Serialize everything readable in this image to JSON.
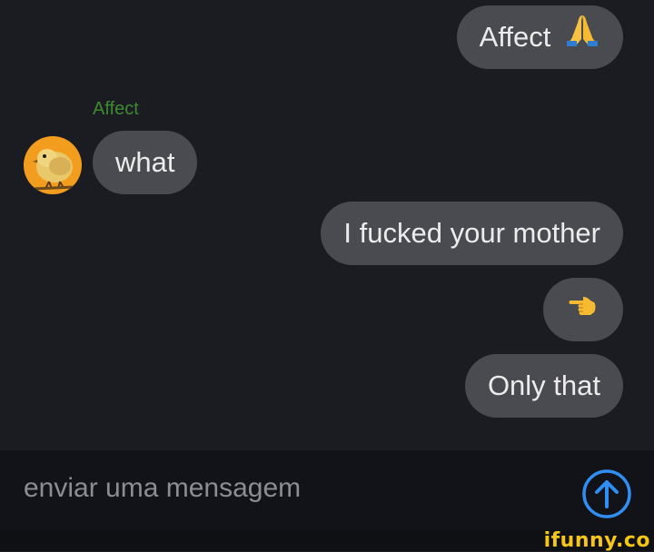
{
  "messages": [
    {
      "text": "Affect",
      "emoji": "praying-hands-icon"
    },
    {
      "sender": "Affect",
      "text": "what"
    },
    {
      "text": "I fucked your mother"
    },
    {
      "emoji": "hand-pointing-left-icon"
    },
    {
      "text": "Only that"
    }
  ],
  "composer": {
    "placeholder": "enviar uma mensagem"
  },
  "watermark": "ifunny.co",
  "colors": {
    "background": "#1b1c22",
    "bubble": "#4a4b50",
    "sender_name": "#3c8a2e",
    "avatar_bg": "#f39d1e",
    "send_accent": "#2f8ff5",
    "watermark": "#f5c518"
  }
}
